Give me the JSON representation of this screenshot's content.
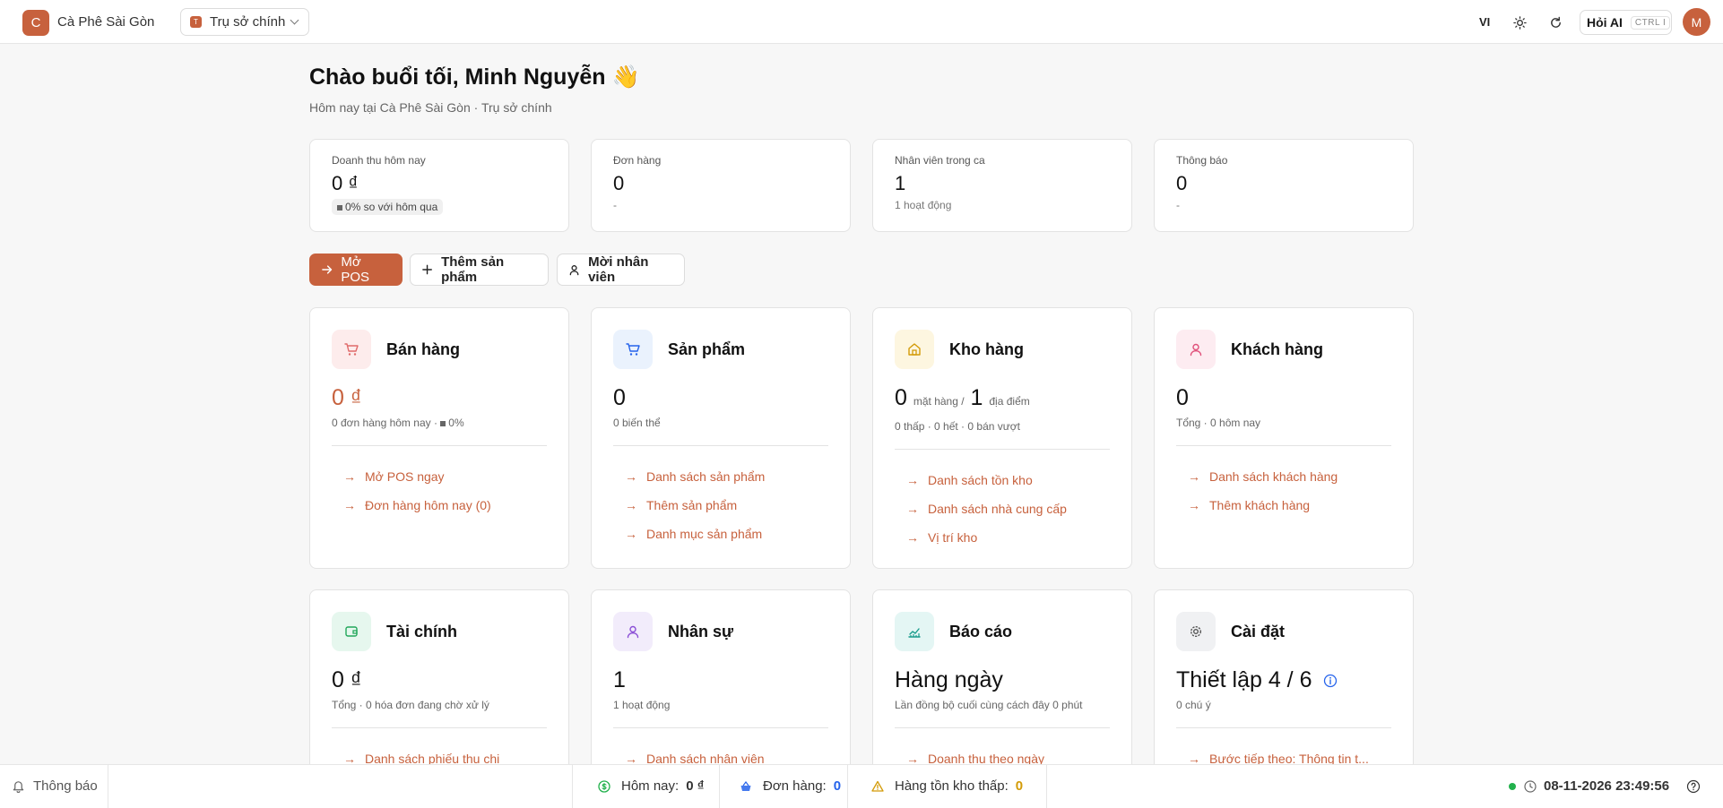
{
  "header": {
    "logo_letter": "C",
    "brand": "Cà Phê Sài Gòn",
    "store_badge": "T",
    "store": "Trụ sở chính",
    "lang": "VI",
    "ai_label": "Hỏi AI",
    "ai_shortcut": "CTRL I",
    "avatar": "M"
  },
  "greeting": {
    "title": "Chào buổi tối, Minh Nguyễn 👋",
    "subtitle": "Hôm nay tại Cà Phê Sài Gòn · Trụ sở chính"
  },
  "stats": [
    {
      "label": "Doanh thu hôm nay",
      "value": "0 ₫",
      "sub": "0% so với hôm qua"
    },
    {
      "label": "Đơn hàng",
      "value": "0",
      "sub": "-"
    },
    {
      "label": "Nhân viên trong ca",
      "value": "1",
      "sub": "1 hoạt động"
    },
    {
      "label": "Thông báo",
      "value": "0",
      "sub": "-"
    }
  ],
  "actions": {
    "open_pos": "Mở POS",
    "add_product": "Thêm sản phẩm",
    "invite_staff": "Mời nhân viên"
  },
  "modules": {
    "sales": {
      "title": "Bán hàng",
      "value": "0 ₫",
      "sub_a": "0 đơn hàng hôm nay · ",
      "sub_b": "0%",
      "links": [
        "Mở POS ngay",
        "Đơn hàng hôm nay (0)"
      ]
    },
    "products": {
      "title": "Sản phẩm",
      "value": "0",
      "sub": "0 biến thể",
      "links": [
        "Danh sách sản phẩm",
        "Thêm sản phẩm",
        "Danh mục sản phẩm"
      ]
    },
    "inventory": {
      "title": "Kho hàng",
      "value_a": "0",
      "unit_a": "mặt hàng /",
      "value_b": "1",
      "unit_b": "địa điểm",
      "sub": "0 thấp · 0 hết · 0 bán vượt",
      "links": [
        "Danh sách tồn kho",
        "Danh sách nhà cung cấp",
        "Vị trí kho"
      ]
    },
    "customers": {
      "title": "Khách hàng",
      "value": "0",
      "sub": "Tổng · 0 hôm nay",
      "links": [
        "Danh sách khách hàng",
        "Thêm khách hàng"
      ]
    },
    "finance": {
      "title": "Tài chính",
      "value": "0 ₫",
      "sub": "Tổng · 0 hóa đơn đang chờ xử lý",
      "links": [
        "Danh sách phiếu thu chi"
      ]
    },
    "hr": {
      "title": "Nhân sự",
      "value": "1",
      "sub": "1 hoạt động",
      "links": [
        "Danh sách nhân viên"
      ]
    },
    "reports": {
      "title": "Báo cáo",
      "value": "Hàng ngày",
      "sub": "Lần đồng bộ cuối cùng cách đây 0 phút",
      "links": [
        "Doanh thu theo ngày"
      ]
    },
    "settings": {
      "title": "Cài đặt",
      "value": "Thiết lập 4 / 6",
      "sub": "0 chú ý",
      "links": [
        "Bước tiếp theo: Thông tin t..."
      ]
    }
  },
  "footer": {
    "notifications": "Thông báo",
    "today_label": "Hôm nay:",
    "today_value": "0 ₫",
    "orders_label": "Đơn hàng:",
    "orders_value": "0",
    "low_stock_label": "Hàng tồn kho thấp:",
    "low_stock_value": "0",
    "datetime": "08-11-2026 23:49:56"
  },
  "colors": {
    "accent": "#c7613d",
    "blue": "#2563eb",
    "amber": "#d39b08",
    "green": "#22b14c"
  }
}
